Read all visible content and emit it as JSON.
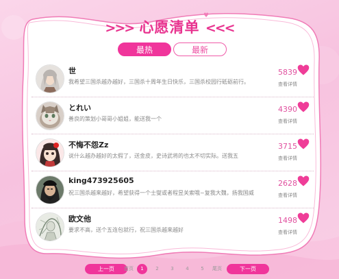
{
  "title": {
    "left_arrows": ">>>",
    "text": "心愿清单",
    "right_arrows": "<<<"
  },
  "tabs": [
    {
      "label": "最热",
      "active": true
    },
    {
      "label": "最新",
      "active": false
    }
  ],
  "list": [
    {
      "name": "世",
      "wish": "我希望三国杀越办越好，三国杀十周年生日快乐，三国杀校园行砥砺前行。",
      "count": "5839",
      "detail": "查看详情",
      "avatar": "silver-hair-warrior"
    },
    {
      "name": "とれい",
      "wish": "善良的策划小哥哥小姐姐，能送我一个",
      "count": "4390",
      "detail": "查看详情",
      "avatar": "cat"
    },
    {
      "name": "不悔不怨Zz",
      "wish": "说什么越办越好的太假了，送金皮，史诗武将的也太不切实际。送我五",
      "count": "3715",
      "detail": "查看详情",
      "avatar": "anime-girl"
    },
    {
      "name": "king473925605",
      "wish": "祝三国杀越来越好，希望获得一个士燮或者程昱关索哦~复我大魏，扬我国威",
      "count": "2628",
      "detail": "查看详情",
      "avatar": "bearded-hero"
    },
    {
      "name": "欧文他",
      "wish": "要求不高，送个五连包就行，祝三国杀越来越好",
      "count": "1498",
      "detail": "查看详情",
      "avatar": "sketch-figure"
    }
  ],
  "pager": {
    "prev": "上一页",
    "first": "首页",
    "pages": [
      "1",
      "2",
      "3",
      "4",
      "5"
    ],
    "current": "1",
    "last": "尾页",
    "next": "下一页"
  },
  "colors": {
    "accent": "#f0359b",
    "count": "#e04f9e",
    "background": "#f7c2df"
  }
}
